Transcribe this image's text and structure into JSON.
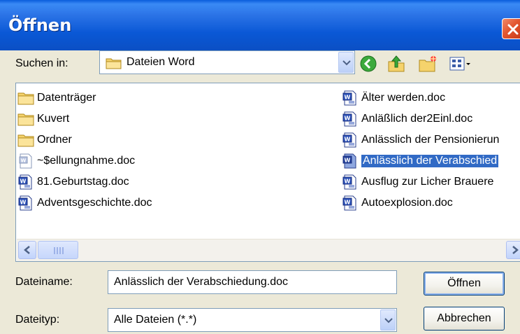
{
  "window": {
    "title": "Öffnen"
  },
  "lookin": {
    "label": "Suchen in:",
    "value": "Dateien Word"
  },
  "toolbar": {
    "icons": [
      "back-icon",
      "up-folder-icon",
      "new-folder-icon",
      "view-menu-icon"
    ]
  },
  "files": [
    {
      "name": "Datenträger",
      "type": "folder"
    },
    {
      "name": "Kuvert",
      "type": "folder"
    },
    {
      "name": "Ordner",
      "type": "folder"
    },
    {
      "name": "~$ellungnahme.doc",
      "type": "doc-temp"
    },
    {
      "name": "81.Geburtstag.doc",
      "type": "doc"
    },
    {
      "name": "Adventsgeschichte.doc",
      "type": "doc"
    },
    {
      "name": "Älter werden.doc",
      "type": "doc"
    },
    {
      "name": "Anläßlich der2Einl.doc",
      "type": "doc"
    },
    {
      "name": "Anlässlich der Pensionierun",
      "type": "doc"
    },
    {
      "name": "Anlässlich der Verabschied",
      "type": "doc",
      "selected": true
    },
    {
      "name": "Ausflug zur Licher Brauere",
      "type": "doc"
    },
    {
      "name": "Autoexplosion.doc",
      "type": "doc"
    }
  ],
  "form": {
    "filename_label": "Dateiname:",
    "filename_value": "Anlässlich der Verabschiedung.doc",
    "filetype_label": "Dateityp:",
    "filetype_value": "Alle Dateien (*.*)"
  },
  "buttons": {
    "open": "Öffnen",
    "cancel": "Abbrechen"
  },
  "colors": {
    "titlebar": "#0a58d6",
    "selection": "#316ac5",
    "dialog_bg": "#ece9d8"
  }
}
